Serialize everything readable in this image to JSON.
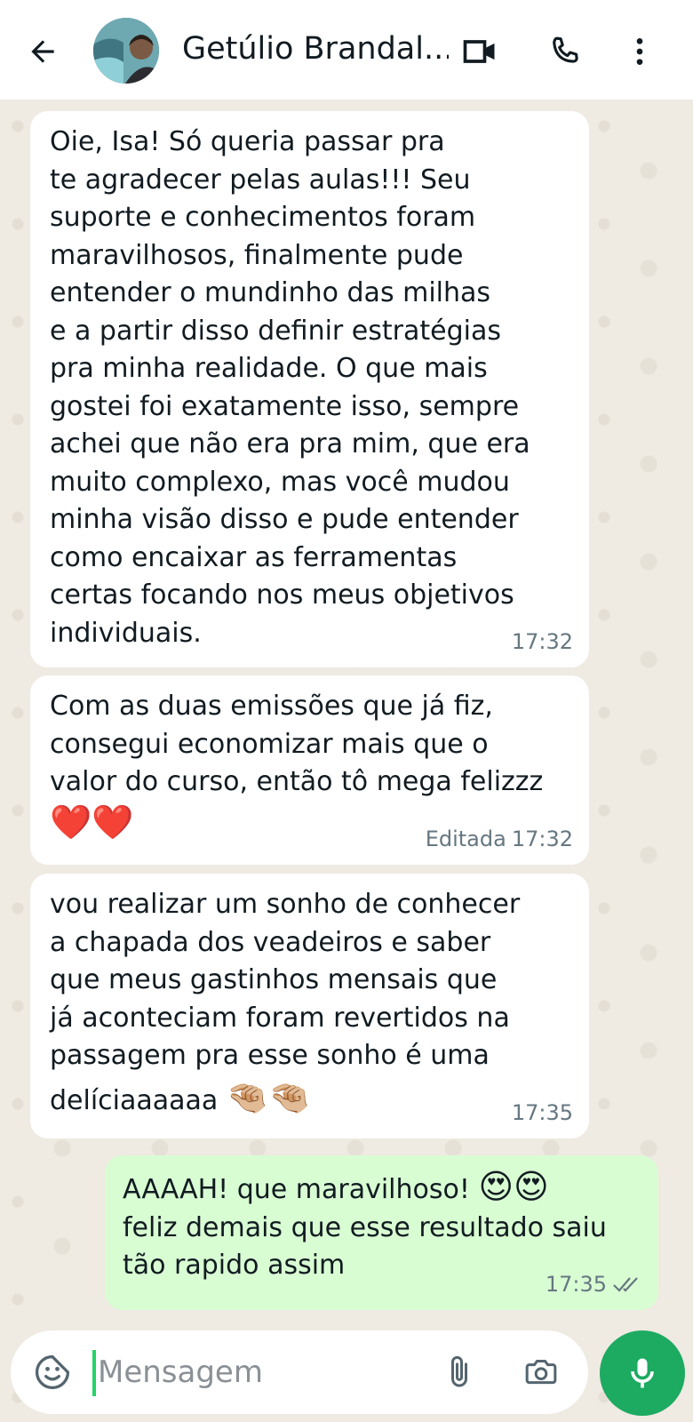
{
  "header": {
    "contact_name": "Getúlio Brandal...",
    "back_icon": "arrow-left-icon",
    "video_icon": "video-camera-icon",
    "call_icon": "phone-icon",
    "menu_icon": "more-vertical-icon"
  },
  "messages": [
    {
      "direction": "incoming",
      "text": "Oie, Isa! Só queria passar pra\nte agradecer pelas aulas!!! Seu\nsuporte e conhecimentos foram\nmaravilhosos, finalmente pude\nentender o mundinho das milhas\ne a partir disso definir estratégias\npra minha realidade. O que mais\ngostei foi exatamente isso, sempre\nachei que não era pra mim, que era\nmuito complexo, mas você mudou\nminha visão disso e pude entender\ncomo encaixar as ferramentas\ncertas focando nos meus objetivos\nindividuais.",
      "time": "17:32"
    },
    {
      "direction": "incoming",
      "text": "Com as duas emissões que já fiz,\nconsegui economizar mais que o\nvalor do curso, então tô mega felizzz",
      "emoji": "❤️❤️",
      "edited_label": "Editada",
      "time": "17:32"
    },
    {
      "direction": "incoming",
      "text": "vou realizar um sonho de conhecer\na chapada dos veadeiros e saber\nque meus gastinhos mensais que\njá aconteciam foram revertidos na\npassagem pra esse sonho é uma",
      "last_line": "delíciaaaaaa",
      "emoji": "🤏🏼🤏🏼",
      "time": "17:35"
    },
    {
      "direction": "outgoing",
      "first_line": "AAAAH! que maravilhoso!",
      "emoji": "😍😍",
      "text": "feliz demais que esse resultado saiu\ntão rapido assim",
      "time": "17:35",
      "status_icon": "double-check-icon"
    }
  ],
  "input": {
    "placeholder": "Mensagem",
    "value": ""
  },
  "colors": {
    "outgoing_bubble": "#d9fdd3",
    "incoming_bubble": "#ffffff",
    "chat_background": "#efeae2",
    "mic_button": "#1daa61"
  }
}
